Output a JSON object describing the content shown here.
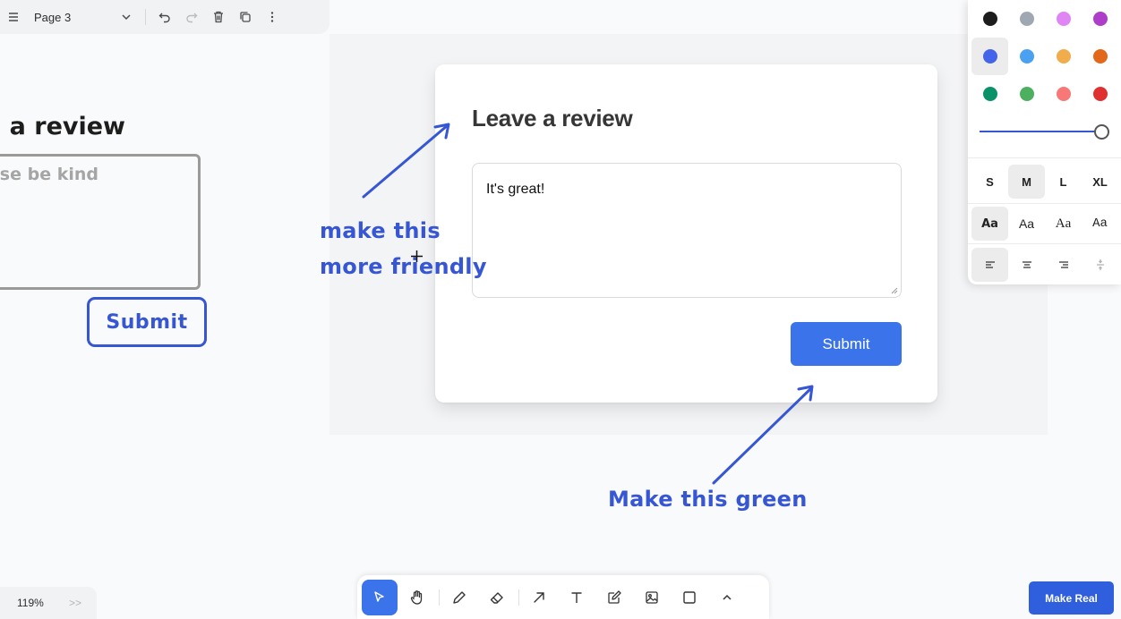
{
  "page_menu": {
    "page_name": "Page 3"
  },
  "sketch": {
    "title": "Leave a review",
    "placeholder": "Please be kind...",
    "submit_label": "Submit"
  },
  "card": {
    "title": "Leave a review",
    "textarea_value": "It's great!",
    "submit_label": "Submit"
  },
  "annotations": {
    "friendly_line1": "make this",
    "friendly_line2": "more friendly",
    "green": "Make this green",
    "color": "#3656d4"
  },
  "style_panel": {
    "colors": [
      {
        "name": "black",
        "hex": "#1d1d1d"
      },
      {
        "name": "grey",
        "hex": "#9fa8b2"
      },
      {
        "name": "light-violet",
        "hex": "#e085f4"
      },
      {
        "name": "violet",
        "hex": "#ae3ec9"
      },
      {
        "name": "blue",
        "hex": "#4465e9",
        "selected": true
      },
      {
        "name": "light-blue",
        "hex": "#4ba1f1"
      },
      {
        "name": "yellow",
        "hex": "#f1ac4b"
      },
      {
        "name": "orange",
        "hex": "#e16919"
      },
      {
        "name": "green",
        "hex": "#099268"
      },
      {
        "name": "light-green",
        "hex": "#4cb05e"
      },
      {
        "name": "light-red",
        "hex": "#f87777"
      },
      {
        "name": "red",
        "hex": "#e03131"
      }
    ],
    "opacity": 1.0,
    "sizes": [
      {
        "label": "S"
      },
      {
        "label": "M",
        "selected": true
      },
      {
        "label": "L"
      },
      {
        "label": "XL"
      }
    ],
    "fonts": [
      {
        "label": "Aa",
        "kind": "draw",
        "selected": true
      },
      {
        "label": "Aa",
        "kind": "sans"
      },
      {
        "label": "Aa",
        "kind": "serif"
      },
      {
        "label": "Aa",
        "kind": "mono"
      }
    ],
    "align": [
      "align-left-icon",
      "align-center-icon",
      "align-right-icon",
      "align-vertical-icon"
    ]
  },
  "zoom": {
    "value": "119%",
    "more": ">>"
  },
  "toolbar": {
    "tools": [
      "select-icon",
      "hand-icon",
      "draw-icon",
      "eraser-icon",
      "arrow-icon",
      "text-icon",
      "note-icon",
      "media-icon",
      "rectangle-icon",
      "more-icon"
    ],
    "active": "select-icon"
  },
  "make_real": {
    "label": "Make Real"
  }
}
